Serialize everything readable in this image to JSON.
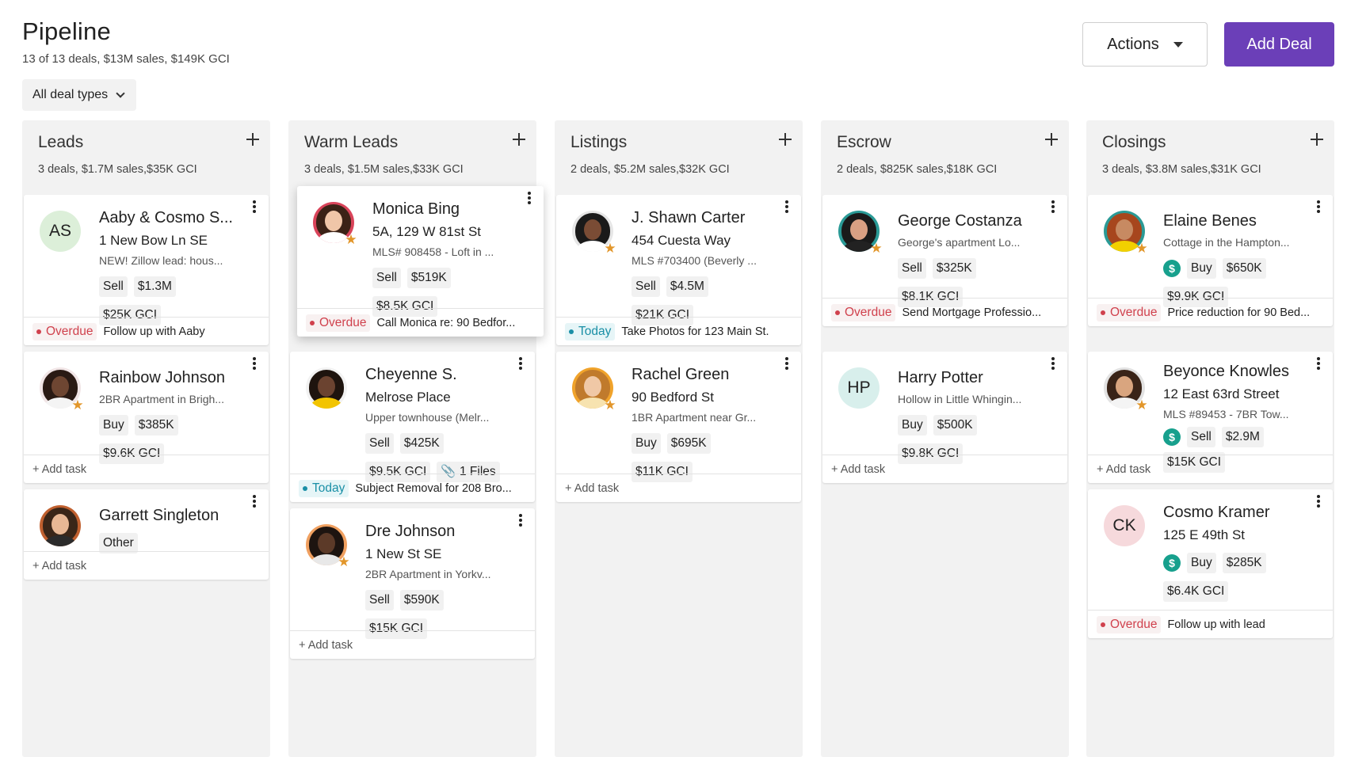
{
  "header": {
    "title": "Pipeline",
    "summary": "13 of 13 deals, $13M sales, $149K GCI",
    "filter_label": "All deal types",
    "actions_label": "Actions",
    "add_deal_label": "Add Deal"
  },
  "colors": {
    "accent": "#6b3fb8",
    "overdue": "#d0414d",
    "today": "#1a8fa6",
    "star": "#e2962a",
    "money": "#17a08d"
  },
  "add_task_label": "+ Add task",
  "columns": [
    {
      "title": "Leads",
      "summary": "3 deals, $1.7M sales,$35K GCI",
      "cards": [
        {
          "name": "Aaby & Cosmo S...",
          "address": "1 New Bow Ln SE",
          "note": "NEW! Zillow lead: hous...",
          "avatar": "AS",
          "type": "Sell",
          "price": "$1.3M",
          "gci": "$25K GCI",
          "task_status": "Overdue",
          "task": "Follow up with Aaby"
        },
        {
          "name": "Rainbow Johnson",
          "note": "2BR Apartment in Brigh...",
          "avatar_icon": "person-photo",
          "type": "Buy",
          "price": "$385K",
          "gci": "$9.6K GCI"
        },
        {
          "name": "Garrett Singleton",
          "avatar_icon": "person-photo",
          "type": "Other"
        }
      ]
    },
    {
      "title": "Warm Leads",
      "summary": "3 deals, $1.5M sales,$33K GCI",
      "cards": [
        {
          "name": "Monica Bing",
          "address": "5A, 129 W 81st St",
          "note": "MLS# 908458 - Loft in ...",
          "avatar_icon": "person-photo",
          "type": "Sell",
          "price": "$519K",
          "gci": "$8.5K GCI",
          "task_status": "Overdue",
          "task": "Call Monica re: 90 Bedfor..."
        },
        {
          "name": "Cheyenne S.",
          "address": "Melrose Place",
          "note": "Upper townhouse (Melr...",
          "avatar_icon": "person-photo",
          "type": "Sell",
          "price": "$425K",
          "gci": "$9.5K GCI",
          "files": "1 Files",
          "task_status": "Today",
          "task": "Subject Removal for 208 Bro..."
        },
        {
          "name": "Dre Johnson",
          "address": "1 New St SE",
          "note": "2BR Apartment in Yorkv...",
          "avatar_icon": "person-photo",
          "type": "Sell",
          "price": "$590K",
          "gci": "$15K GCI"
        }
      ]
    },
    {
      "title": "Listings",
      "summary": "2 deals, $5.2M sales,$32K GCI",
      "cards": [
        {
          "name": "J. Shawn Carter",
          "address": "454 Cuesta Way",
          "note": "MLS #703400 (Beverly ...",
          "avatar_icon": "person-photo",
          "type": "Sell",
          "price": "$4.5M",
          "gci": "$21K GCI",
          "task_status": "Today",
          "task": "Take Photos for 123 Main St."
        },
        {
          "name": "Rachel Green",
          "address": "90 Bedford St",
          "note": "1BR Apartment near Gr...",
          "avatar_icon": "person-photo",
          "type": "Buy",
          "price": "$695K",
          "gci": "$11K GCI"
        }
      ]
    },
    {
      "title": "Escrow",
      "summary": "2 deals, $825K sales,$18K GCI",
      "cards": [
        {
          "name": "George Costanza",
          "note": "George's apartment Lo...",
          "avatar_icon": "person-photo",
          "type": "Sell",
          "price": "$325K",
          "gci": "$8.1K GCI",
          "task_status": "Overdue",
          "task": "Send Mortgage Professio..."
        },
        {
          "name": "Harry Potter",
          "note": "Hollow in Little Whingin...",
          "avatar": "HP",
          "type": "Buy",
          "price": "$500K",
          "gci": "$9.8K GCI"
        }
      ]
    },
    {
      "title": "Closings",
      "summary": "3 deals, $3.8M sales,$31K GCI",
      "cards": [
        {
          "name": "Elaine Benes",
          "note": "Cottage in the Hampton...",
          "avatar_icon": "person-photo",
          "type": "Buy",
          "price": "$650K",
          "gci": "$9.9K GCI",
          "task_status": "Overdue",
          "task": "Price reduction for 90 Bed..."
        },
        {
          "name": "Beyonce Knowles",
          "address": "12 East 63rd Street",
          "note": "MLS #89453 - 7BR Tow...",
          "avatar_icon": "person-photo",
          "type": "Sell",
          "price": "$2.9M",
          "gci": "$15K GCI"
        },
        {
          "name": "Cosmo Kramer",
          "address": "125 E 49th St",
          "avatar": "CK",
          "type": "Buy",
          "price": "$285K",
          "gci": "$6.4K GCI",
          "task_status": "Overdue",
          "task": "Follow up with lead"
        }
      ]
    }
  ]
}
